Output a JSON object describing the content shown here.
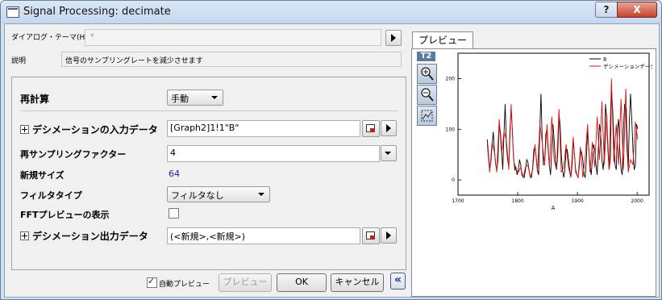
{
  "window": {
    "title": "Signal Processing: decimate",
    "help_label": "?",
    "close_label": "X"
  },
  "dialog_theme": {
    "label": "ダイアログ・テーマ(H)",
    "value": "*"
  },
  "description": {
    "label": "説明",
    "text": "信号のサンプリングレートを減少させます"
  },
  "settings": {
    "recalc_label": "再計算",
    "recalc_value": "手動",
    "input_label": "デシメーションの入力データ",
    "input_value": "[Graph2]1!1\"B\"",
    "resample_label": "再サンプリングファクター",
    "resample_value": "4",
    "new_size_label": "新規サイズ",
    "new_size_value": "64",
    "filter_label": "フィルタタイプ",
    "filter_value": "フィルタなし",
    "fft_label": "FFTプレビューの表示",
    "output_label": "デシメーション出力データ",
    "output_value": "(<新規>,<新規>)"
  },
  "footer": {
    "auto_preview_label": "自動プレビュー",
    "preview_button": "プレビュー",
    "ok_button": "OK",
    "cancel_button": "キャンセル",
    "collapse_button": "«"
  },
  "preview": {
    "tab_label": "プレビュー",
    "graph_tag": "T2"
  },
  "colors": {
    "series_b": "#000000",
    "series_decimated": "#e01010",
    "new_size": "#1a1aa0"
  },
  "chart_data": {
    "type": "line",
    "xlabel": "A",
    "ylabel": "",
    "xlim": [
      1700,
      2020
    ],
    "ylim": [
      -30,
      250
    ],
    "xticks": [
      1700,
      1800,
      1900,
      2000
    ],
    "yticks": [
      0,
      100,
      200
    ],
    "legend": "top-right",
    "series": [
      {
        "name": "B",
        "color": "#000000",
        "x": [
          1749,
          1751,
          1753,
          1755,
          1757,
          1759,
          1761,
          1763,
          1765,
          1767,
          1769,
          1771,
          1773,
          1775,
          1777,
          1779,
          1781,
          1783,
          1785,
          1787,
          1789,
          1791,
          1793,
          1795,
          1797,
          1799,
          1801,
          1803,
          1805,
          1807,
          1809,
          1811,
          1813,
          1815,
          1817,
          1819,
          1821,
          1823,
          1825,
          1827,
          1829,
          1831,
          1833,
          1835,
          1837,
          1839,
          1841,
          1843,
          1845,
          1847,
          1849,
          1851,
          1853,
          1855,
          1857,
          1859,
          1861,
          1863,
          1865,
          1867,
          1869,
          1871,
          1873,
          1875,
          1877,
          1879,
          1881,
          1883,
          1885,
          1887,
          1889,
          1891,
          1893,
          1895,
          1897,
          1899,
          1901,
          1903,
          1905,
          1907,
          1909,
          1911,
          1913,
          1915,
          1917,
          1919,
          1921,
          1923,
          1925,
          1927,
          1929,
          1931,
          1933,
          1935,
          1937,
          1939,
          1941,
          1943,
          1945,
          1947,
          1949,
          1951,
          1953,
          1955,
          1957,
          1959,
          1961,
          1963,
          1965,
          1967,
          1969,
          1971,
          1973,
          1975,
          1977,
          1979,
          1981,
          1983,
          1985,
          1987,
          1989,
          1991,
          1993,
          1995,
          1997,
          1999,
          2001
        ],
        "y": [
          80,
          50,
          20,
          35,
          65,
          95,
          60,
          30,
          20,
          40,
          110,
          95,
          60,
          20,
          90,
          150,
          70,
          40,
          25,
          100,
          140,
          100,
          45,
          20,
          25,
          10,
          20,
          40,
          30,
          10,
          5,
          5,
          20,
          40,
          35,
          20,
          5,
          5,
          25,
          60,
          65,
          45,
          20,
          10,
          100,
          170,
          80,
          30,
          30,
          90,
          100,
          60,
          30,
          10,
          60,
          110,
          80,
          40,
          20,
          50,
          130,
          110,
          50,
          20,
          5,
          20,
          60,
          60,
          40,
          20,
          5,
          30,
          80,
          50,
          20,
          10,
          5,
          25,
          60,
          55,
          40,
          10,
          5,
          40,
          100,
          60,
          30,
          10,
          40,
          70,
          60,
          30,
          10,
          60,
          110,
          90,
          40,
          20,
          50,
          150,
          120,
          60,
          20,
          40,
          180,
          140,
          80,
          30,
          20,
          100,
          120,
          60,
          20,
          10,
          100,
          150,
          140,
          60,
          20,
          120,
          170,
          120,
          60,
          20,
          30,
          110,
          100
        ]
      },
      {
        "name": "デシメーションデータ",
        "color": "#e01010",
        "x": [
          1749,
          1753,
          1757,
          1761,
          1765,
          1769,
          1773,
          1777,
          1781,
          1785,
          1789,
          1793,
          1797,
          1801,
          1805,
          1809,
          1813,
          1817,
          1821,
          1825,
          1829,
          1833,
          1837,
          1841,
          1845,
          1849,
          1853,
          1857,
          1861,
          1865,
          1869,
          1873,
          1877,
          1881,
          1885,
          1889,
          1893,
          1897,
          1901,
          1905,
          1909,
          1913,
          1917,
          1921,
          1925,
          1929,
          1933,
          1937,
          1941,
          1945,
          1949,
          1953,
          1957,
          1961,
          1965,
          1969,
          1973,
          1977,
          1981,
          1985,
          1989,
          1993,
          1997,
          2001
        ],
        "y": [
          70,
          15,
          75,
          55,
          15,
          120,
          50,
          95,
          80,
          20,
          150,
          40,
          20,
          15,
          25,
          5,
          25,
          30,
          5,
          20,
          70,
          15,
          110,
          75,
          30,
          110,
          25,
          125,
          40,
          20,
          140,
          15,
          25,
          70,
          25,
          5,
          85,
          15,
          5,
          65,
          5,
          45,
          110,
          15,
          75,
          25,
          125,
          40,
          155,
          30,
          130,
          20,
          200,
          35,
          110,
          30,
          160,
          20,
          180,
          15,
          40,
          30,
          115,
          80
        ]
      }
    ]
  }
}
